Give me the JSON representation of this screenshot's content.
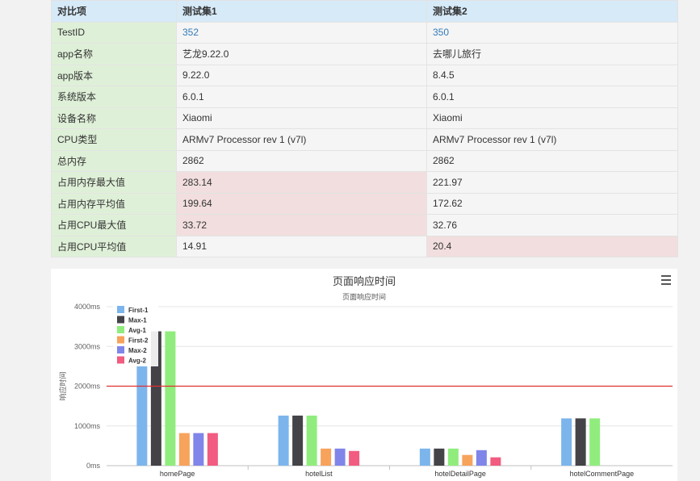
{
  "table": {
    "headers": [
      "对比项",
      "测试集1",
      "测试集2"
    ],
    "rows": [
      {
        "label": "TestID",
        "v1": "352",
        "v2": "350",
        "link": true,
        "hl1": false,
        "hl2": false
      },
      {
        "label": "app名称",
        "v1": "艺龙9.22.0",
        "v2": "去哪儿旅行",
        "hl1": false,
        "hl2": false
      },
      {
        "label": "app版本",
        "v1": "9.22.0",
        "v2": "8.4.5",
        "hl1": false,
        "hl2": false
      },
      {
        "label": "系统版本",
        "v1": "6.0.1",
        "v2": "6.0.1",
        "hl1": false,
        "hl2": false
      },
      {
        "label": "设备名称",
        "v1": "Xiaomi",
        "v2": "Xiaomi",
        "hl1": false,
        "hl2": false
      },
      {
        "label": "CPU类型",
        "v1": "ARMv7 Processor rev 1 (v7l)",
        "v2": "ARMv7 Processor rev 1 (v7l)",
        "hl1": false,
        "hl2": false
      },
      {
        "label": "总内存",
        "v1": "2862",
        "v2": "2862",
        "hl1": false,
        "hl2": false
      },
      {
        "label": "占用内存最大值",
        "v1": "283.14",
        "v2": "221.97",
        "hl1": true,
        "hl2": false
      },
      {
        "label": "占用内存平均值",
        "v1": "199.64",
        "v2": "172.62",
        "hl1": true,
        "hl2": false
      },
      {
        "label": "占用CPU最大值",
        "v1": "33.72",
        "v2": "32.76",
        "hl1": true,
        "hl2": false
      },
      {
        "label": "占用CPU平均值",
        "v1": "14.91",
        "v2": "20.4",
        "hl1": false,
        "hl2": true
      }
    ]
  },
  "chart": {
    "title": "页面响应时间",
    "menu_icon": "hamburger-menu-icon"
  },
  "chart_data": {
    "type": "bar",
    "title": "页面响应时间",
    "subtitle": "页面响应时间",
    "ylabel": "响应时间",
    "ylim": [
      0,
      4000
    ],
    "yticks": [
      "0ms",
      "1000ms",
      "2000ms",
      "3000ms",
      "4000ms"
    ],
    "tick_values": [
      0,
      1000,
      2000,
      3000,
      4000
    ],
    "threshold": 2000,
    "threshold_color": "#e03030",
    "legend_position": "top-left",
    "categories": [
      "homePage",
      "hotelList",
      "hotelDetailPage",
      "hotelCommentPage"
    ],
    "series": [
      {
        "name": "First-1",
        "color": "#7cb5ec",
        "values": [
          2500,
          1260,
          430,
          1190
        ]
      },
      {
        "name": "Max-1",
        "color": "#434348",
        "values": [
          3380,
          1260,
          430,
          1190
        ]
      },
      {
        "name": "Avg-1",
        "color": "#90ed7d",
        "values": [
          3380,
          1260,
          430,
          1190
        ]
      },
      {
        "name": "First-2",
        "color": "#f7a35c",
        "values": [
          820,
          430,
          270,
          null
        ]
      },
      {
        "name": "Max-2",
        "color": "#8085e9",
        "values": [
          820,
          430,
          390,
          null
        ]
      },
      {
        "name": "Avg-2",
        "color": "#f15c80",
        "values": [
          820,
          370,
          210,
          null
        ]
      }
    ]
  }
}
